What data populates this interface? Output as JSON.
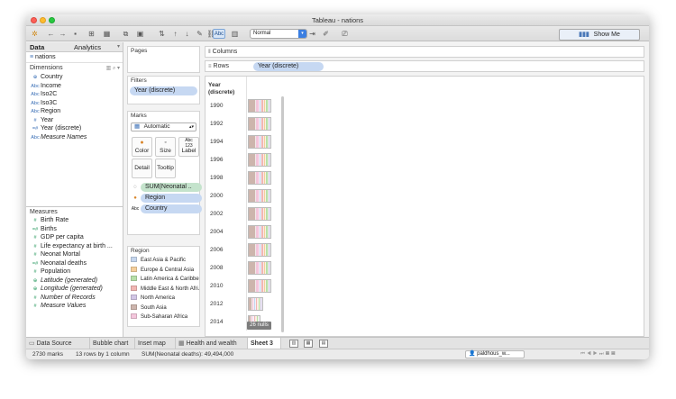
{
  "window": {
    "title": "Tableau - nations"
  },
  "toolbar": {
    "fit_value": "Normal",
    "show_me_label": "Show Me",
    "abc_label": "Abc"
  },
  "data_pane": {
    "tabs": [
      "Data",
      "Analytics"
    ],
    "datasource": "nations",
    "dimensions_label": "Dimensions",
    "dimensions": [
      {
        "icon": "globe",
        "glyph": "⊕",
        "label": "Country",
        "italic": false
      },
      {
        "icon": "abc",
        "glyph": "Abc",
        "label": "Income",
        "italic": false
      },
      {
        "icon": "abc",
        "glyph": "Abc",
        "label": "Iso2C",
        "italic": false
      },
      {
        "icon": "abc",
        "glyph": "Abc",
        "label": "Iso3C",
        "italic": false
      },
      {
        "icon": "abc",
        "glyph": "Abc",
        "label": "Region",
        "italic": false
      },
      {
        "icon": "hash",
        "glyph": "#",
        "label": "Year",
        "italic": false
      },
      {
        "icon": "calc-hash",
        "glyph": "=#",
        "label": "Year (discrete)",
        "italic": false
      },
      {
        "icon": "abc",
        "glyph": "Abc",
        "label": "Measure Names",
        "italic": true
      }
    ],
    "measures_label": "Measures",
    "measures": [
      {
        "icon": "hash",
        "glyph": "#",
        "label": "Birth Rate",
        "italic": false
      },
      {
        "icon": "calc-hash",
        "glyph": "=#",
        "label": "Births",
        "italic": false
      },
      {
        "icon": "hash",
        "glyph": "#",
        "label": "GDP per capita",
        "italic": false
      },
      {
        "icon": "hash",
        "glyph": "#",
        "label": "Life expectancy at birth ...",
        "italic": false
      },
      {
        "icon": "hash",
        "glyph": "#",
        "label": "Neonat Mortal",
        "italic": false
      },
      {
        "icon": "calc-hash",
        "glyph": "=#",
        "label": "Neonatal deaths",
        "italic": false
      },
      {
        "icon": "hash",
        "glyph": "#",
        "label": "Population",
        "italic": false
      },
      {
        "icon": "globe",
        "glyph": "⊕",
        "label": "Latitude (generated)",
        "italic": true
      },
      {
        "icon": "globe",
        "glyph": "⊕",
        "label": "Longitude (generated)",
        "italic": true
      },
      {
        "icon": "hash",
        "glyph": "#",
        "label": "Number of Records",
        "italic": true
      },
      {
        "icon": "hash",
        "glyph": "#",
        "label": "Measure Values",
        "italic": true
      }
    ]
  },
  "cards": {
    "pages_label": "Pages",
    "filters_label": "Filters",
    "filters": [
      "Year (discrete)"
    ],
    "marks_label": "Marks",
    "mark_type": "Automatic",
    "mark_buttons": [
      {
        "label": "Color",
        "glyph": "●"
      },
      {
        "label": "Size",
        "glyph": "◦"
      },
      {
        "label": "Label",
        "glyph": "Abc\n123"
      },
      {
        "label": "Detail",
        "glyph": ""
      },
      {
        "label": "Tooltip",
        "glyph": ""
      }
    ],
    "mark_fields": [
      {
        "label": "SUM(Neonatal ..",
        "color": "green",
        "icon": "◌"
      },
      {
        "label": "Region",
        "color": "blue",
        "icon": "●"
      },
      {
        "label": "Country",
        "color": "blue",
        "icon": "Abc"
      }
    ],
    "legend_title": "Region",
    "legend": [
      {
        "label": "East Asia & Pacific",
        "color": "#c5d6ee"
      },
      {
        "label": "Europe & Central Asia",
        "color": "#f5cf9c"
      },
      {
        "label": "Latin America & Caribbe..",
        "color": "#b7dfa8"
      },
      {
        "label": "Middle East & North Afri..",
        "color": "#f2b6b3"
      },
      {
        "label": "North America",
        "color": "#d2c6e6"
      },
      {
        "label": "South Asia",
        "color": "#cdb5ad"
      },
      {
        "label": "Sub-Saharan Africa",
        "color": "#f4c6dc"
      }
    ]
  },
  "shelves": {
    "columns_label": "Columns",
    "rows_label": "Rows",
    "rows_pill": "Year (discrete)"
  },
  "view": {
    "header": "Year (discrete)",
    "years": [
      "1990",
      "1992",
      "1994",
      "1996",
      "1998",
      "2000",
      "2002",
      "2004",
      "2006",
      "2008",
      "2010",
      "2012",
      "2014"
    ],
    "nulls_label": "26 nulls"
  },
  "sheet_tabs": [
    "Data Source",
    "Bubble chart",
    "Inset map",
    "Health and wealth",
    "Sheet 3"
  ],
  "status": {
    "marks": "2730 marks",
    "rows_cols": "13 rows by 1 column",
    "sum": "SUM(Neonatal deaths): 49,494,000",
    "user": "paldhous_w..."
  }
}
